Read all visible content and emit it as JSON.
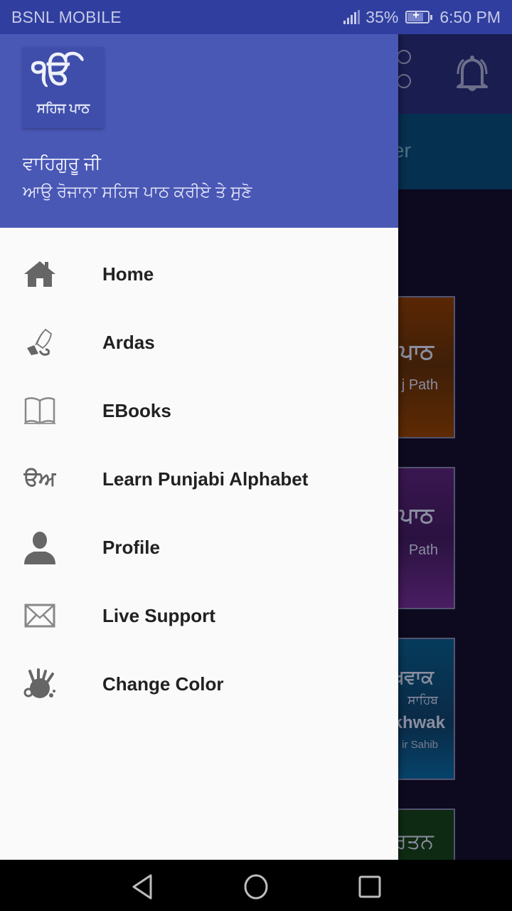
{
  "status_bar": {
    "carrier": "BSNL MOBILE",
    "battery_percent": "35%",
    "time": "6:50 PM",
    "icons": [
      "signal-icon",
      "battery-charging-icon"
    ]
  },
  "background_app": {
    "tab_partial_text": "nder",
    "toolbar_icons": [
      "overflow-menu-icon",
      "bell-icon"
    ],
    "cards": [
      {
        "title_partial": "ਪਾਠ",
        "subtitle_partial": "j Path",
        "color": "#5a2704"
      },
      {
        "title_partial": "ਪਾਠ",
        "subtitle_partial": "Path",
        "color": "#3a1650"
      },
      {
        "title_partial": "ਖਵਾਕ",
        "line2": "ਸਾਹਿਬ",
        "line3_partial": "khwak",
        "line4_partial": "ir Sahib",
        "color": "#063b5c"
      },
      {
        "title_partial": "ੀਰਤਨ",
        "color": "#0f2a12"
      }
    ]
  },
  "drawer": {
    "header": {
      "logo_main": "ੴ",
      "logo_sub": "ਸਹਿਜ ਪਾਠ",
      "title": "ਵਾਹਿਗੁਰੂ ਜੀ",
      "subtitle": "ਆਉ ਰੋਜਾਨਾ ਸਹਿਜ ਪਾਠ ਕਰੀਏ ਤੇ ਸੁਣੋ",
      "background_color": "#4957b5"
    },
    "menu": [
      {
        "label": "Home",
        "icon": "home-icon"
      },
      {
        "label": "Ardas",
        "icon": "praying-hands-icon"
      },
      {
        "label": "EBooks",
        "icon": "open-book-icon"
      },
      {
        "label": "Learn Punjabi Alphabet",
        "icon": "gurmukhi-letters-icon"
      },
      {
        "label": "Profile",
        "icon": "user-icon"
      },
      {
        "label": "Live Support",
        "icon": "envelope-icon"
      },
      {
        "label": "Change Color",
        "icon": "paint-splash-icon"
      }
    ]
  },
  "nav_bar": {
    "buttons": [
      "back-button",
      "home-button",
      "recents-button"
    ]
  }
}
